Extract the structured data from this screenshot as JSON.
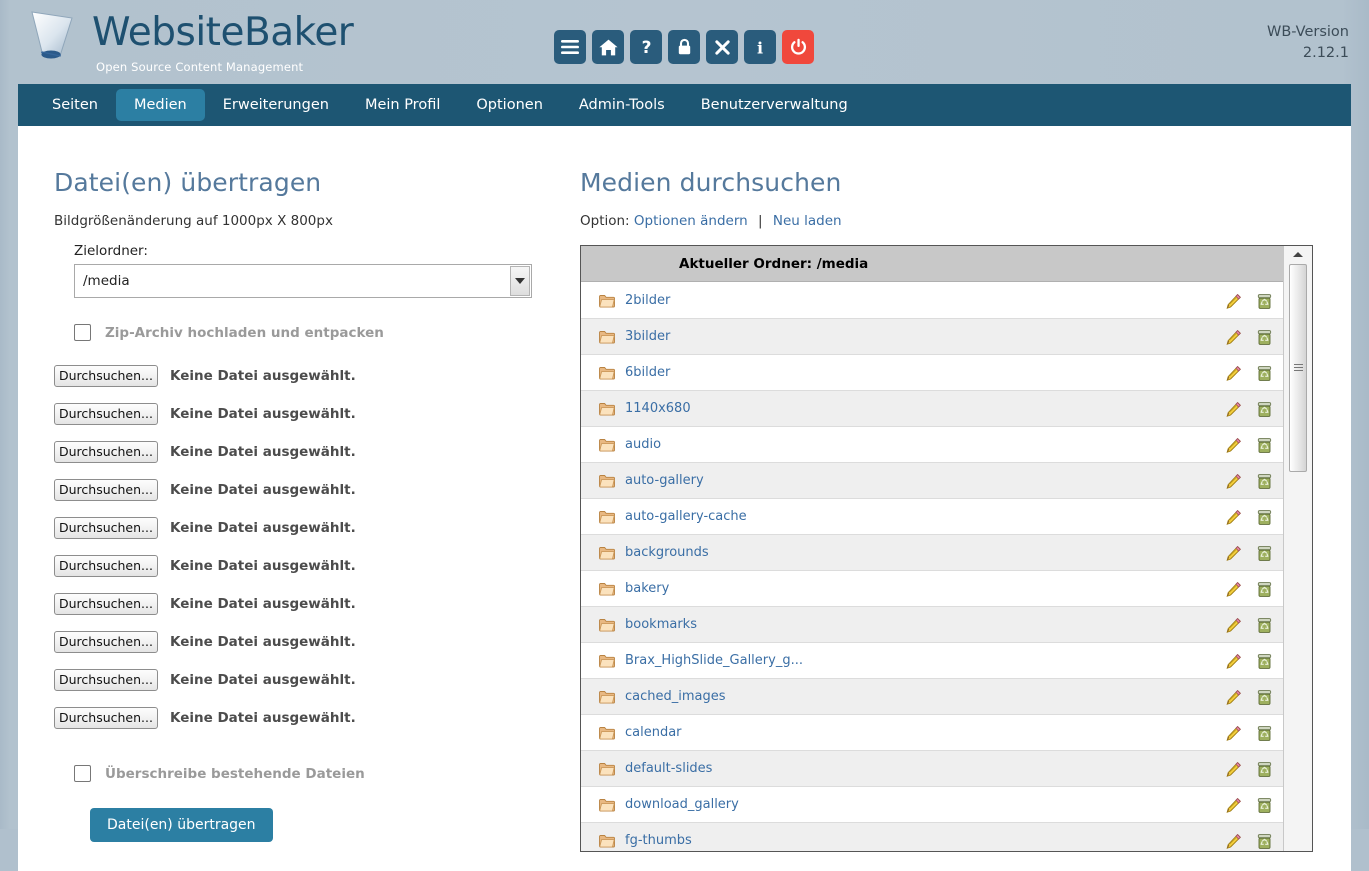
{
  "brand": {
    "name": "WebsiteBaker",
    "tagline": "Open Source Content Management",
    "logo_icon": "cone-logo-icon"
  },
  "header": {
    "version_label": "WB-Version",
    "version_number": "2.12.1",
    "icons": [
      {
        "name": "menu-icon",
        "glyph": "hamburger",
        "color": "#2a5c7c"
      },
      {
        "name": "home-icon",
        "glyph": "home",
        "color": "#2a5c7c"
      },
      {
        "name": "help-icon",
        "glyph": "question",
        "color": "#2a5c7c"
      },
      {
        "name": "lock-icon",
        "glyph": "lock",
        "color": "#2a5c7c"
      },
      {
        "name": "close-icon",
        "glyph": "x",
        "color": "#2a5c7c"
      },
      {
        "name": "info-icon",
        "glyph": "info",
        "color": "#2a5c7c"
      },
      {
        "name": "power-icon",
        "glyph": "power",
        "color": "#f0483c"
      }
    ]
  },
  "nav": {
    "active": "Medien",
    "items": [
      {
        "label": "Seiten"
      },
      {
        "label": "Medien"
      },
      {
        "label": "Erweiterungen"
      },
      {
        "label": "Mein Profil"
      },
      {
        "label": "Optionen"
      },
      {
        "label": "Admin-Tools"
      },
      {
        "label": "Benutzerverwaltung"
      }
    ]
  },
  "upload_panel": {
    "title": "Datei(en) übertragen",
    "resize_note": "Bildgrößenänderung auf 1000px X 800px",
    "target_folder_label": "Zielordner:",
    "target_folder_value": "/media",
    "zip_checkbox_label": "Zip-Archiv hochladen und entpacken",
    "zip_checkbox_checked": false,
    "overwrite_checkbox_label": "Überschreibe bestehende Dateien",
    "overwrite_checkbox_checked": false,
    "browse_button_label": "Durchsuchen...",
    "no_file_label": "Keine Datei ausgewählt.",
    "file_row_count": 10,
    "submit_label": "Datei(en) übertragen"
  },
  "media_panel": {
    "title": "Medien durchsuchen",
    "option_label": "Option:",
    "option_change_link": "Optionen ändern",
    "option_separator": "|",
    "reload_link": "Neu laden",
    "current_folder_header": "Aktueller Ordner: /media",
    "edit_icon_name": "pencil-edit-icon",
    "delete_icon_name": "recycle-bin-delete-icon",
    "folders": [
      {
        "name": "2bilder"
      },
      {
        "name": "3bilder"
      },
      {
        "name": "6bilder"
      },
      {
        "name": "1140x680"
      },
      {
        "name": "audio"
      },
      {
        "name": "auto-gallery"
      },
      {
        "name": "auto-gallery-cache"
      },
      {
        "name": "backgrounds"
      },
      {
        "name": "bakery"
      },
      {
        "name": "bookmarks"
      },
      {
        "name": "Brax_HighSlide_Gallery_g..."
      },
      {
        "name": "cached_images"
      },
      {
        "name": "calendar"
      },
      {
        "name": "default-slides"
      },
      {
        "name": "download_gallery"
      },
      {
        "name": "fg-thumbs"
      }
    ]
  },
  "colors": {
    "page_background": "#b5c4d0",
    "nav_bar": "#1d5673",
    "nav_active": "#2c7fa3",
    "heading": "#55799c",
    "link": "#3a6ea5",
    "accent_button": "#2c7fa3",
    "power_red": "#f0483c",
    "table_header": "#c8c8c8"
  }
}
